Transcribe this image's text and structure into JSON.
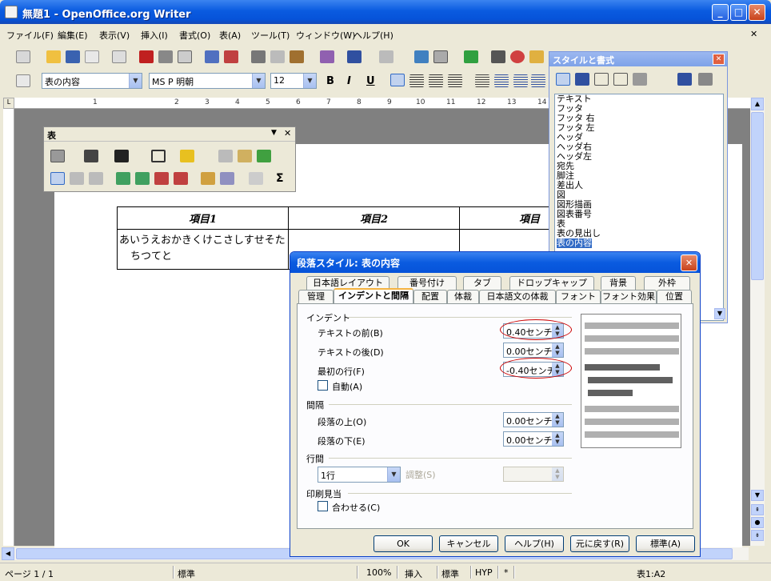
{
  "window": {
    "title": "無題1 - OpenOffice.org Writer",
    "minimize": "_",
    "maximize": "□",
    "close": "✕"
  },
  "menu": [
    "ファイル(F)",
    "編集(E)",
    "表示(V)",
    "挿入(I)",
    "書式(O)",
    "表(A)",
    "ツール(T)",
    "ウィンドウ(W)",
    "ヘルプ(H)"
  ],
  "menu_close": "✕",
  "format_bar": {
    "style": "表の内容",
    "font": "MS P 明朝",
    "size": "12",
    "bold": "B",
    "italic": "I",
    "underline": "U"
  },
  "ruler_marks": [
    "1",
    "2",
    "3",
    "4",
    "5",
    "6",
    "7",
    "8",
    "9",
    "10",
    "11",
    "12",
    "13",
    "14"
  ],
  "table_toolbar": {
    "title": "表",
    "sum": "Σ",
    "close": "✕"
  },
  "document_table": {
    "headers": [
      "項目1",
      "項目2",
      "項目"
    ],
    "cell_text": "あいうえおかきくけこさしすせそたちつてと"
  },
  "styles_panel": {
    "title": "スタイルと書式",
    "close": "✕",
    "items": [
      "テキスト",
      "フッタ",
      "フッタ 右",
      "フッタ 左",
      "ヘッダ",
      "ヘッダ右",
      "ヘッダ左",
      "宛先",
      "脚注",
      "差出人",
      "図",
      "図形描画",
      "図表番号",
      "表",
      "表の見出し",
      "表の内容"
    ],
    "selected": "表の内容"
  },
  "dialog": {
    "title": "段落スタイル: 表の内容",
    "tabs_row1": [
      "日本語レイアウト",
      "番号付け",
      "タブ",
      "ドロップキャップ",
      "背景",
      "外枠"
    ],
    "tabs_row2": [
      "管理",
      "インデントと間隔",
      "配置",
      "体裁",
      "日本語文の体裁",
      "フォント",
      "フォント効果",
      "位置"
    ],
    "active_tab": "インデントと間隔",
    "indent_group": "インデント",
    "before_text_label": "テキストの前(B)",
    "before_text_value": "0.40センチ",
    "after_text_label": "テキストの後(D)",
    "after_text_value": "0.00センチ",
    "first_line_label": "最初の行(F)",
    "first_line_value": "-0.40センチ",
    "auto_label": "自動(A)",
    "spacing_group": "間隔",
    "above_label": "段落の上(O)",
    "above_value": "0.00センチ",
    "below_label": "段落の下(E)",
    "below_value": "0.00センチ",
    "line_spacing_group": "行間",
    "line_spacing_value": "1行",
    "adjust_label": "調整(S)",
    "register_group": "印刷見当",
    "register_label": "合わせる(C)",
    "buttons": {
      "ok": "OK",
      "cancel": "キャンセル",
      "help": "ヘルプ(H)",
      "reset": "元に戻す(R)",
      "standard": "標準(A)"
    }
  },
  "status": {
    "page": "ページ 1 / 1",
    "style": "標準",
    "zoom": "100%",
    "insert": "挿入",
    "mode": "標準",
    "hyp": "HYP",
    "star": "*",
    "cell": "表1:A2"
  }
}
